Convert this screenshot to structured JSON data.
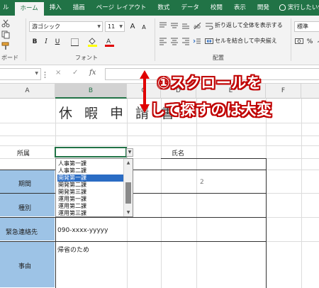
{
  "tabs": [
    {
      "label": "ル",
      "active": false
    },
    {
      "label": "ホーム",
      "active": true
    },
    {
      "label": "挿入",
      "active": false
    },
    {
      "label": "描画",
      "active": false
    },
    {
      "label": "ページ レイアウト",
      "active": false
    },
    {
      "label": "数式",
      "active": false
    },
    {
      "label": "データ",
      "active": false
    },
    {
      "label": "校閲",
      "active": false
    },
    {
      "label": "表示",
      "active": false
    },
    {
      "label": "開発",
      "active": false
    }
  ],
  "tell_me": "実行したい作",
  "ribbon": {
    "font_name": "游ゴシック",
    "font_size": "11",
    "font_group": "フォント",
    "clipboard_group": "ボード",
    "align_group": "配置",
    "wrap_text": "折り返して全体を表示する",
    "merge_center": "セルを結合して中央揃え",
    "number_format": "標準",
    "bold": "B",
    "italic": "I",
    "underline": "U",
    "grow_font": "A",
    "shrink_font": "A",
    "percent": "%",
    "comma": ","
  },
  "formula_bar": {
    "cancel": "×",
    "enter": "✓",
    "fx": "fx",
    "value": ""
  },
  "columns": [
    "A",
    "B",
    "C",
    "D",
    "E",
    "F"
  ],
  "sheet": {
    "title": "休暇申請書",
    "affiliation_label": "所属",
    "name_label": "氏名",
    "period_label": "期間",
    "type_label": "種別",
    "emergency_label": "緊急連絡先",
    "reason_label": "事由",
    "period_partial": "2",
    "period_partial_2": "2",
    "phone": "090-xxxx-yyyyy",
    "reason": "帰省のため"
  },
  "dropdown": {
    "items": [
      "人事第一課",
      "人事第二課",
      "開発第一課",
      "開発第二課",
      "開発第三課",
      "運用第一課",
      "運用第二課",
      "運用第三課"
    ],
    "highlighted_index": 2
  },
  "annotation": {
    "line1": "①スクロールを",
    "line2": "して探すのは大変"
  }
}
